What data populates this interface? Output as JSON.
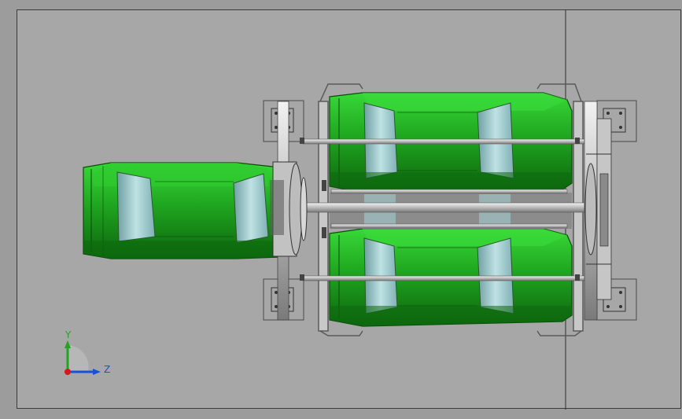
{
  "window": {
    "background": "#a7a7a7"
  },
  "model": {
    "body_color": "#1fa51f",
    "body_highlight": "#33d333",
    "body_shadow": "#0e6a0e",
    "glass_color": "#9fc9cc",
    "frame_color": "#d0d0d0"
  },
  "triad": {
    "y_label": "Y",
    "z_label": "Z",
    "x_axis_color": "#d11a1a",
    "y_axis_color": "#1fa51f",
    "z_axis_color": "#1a4fd8"
  }
}
